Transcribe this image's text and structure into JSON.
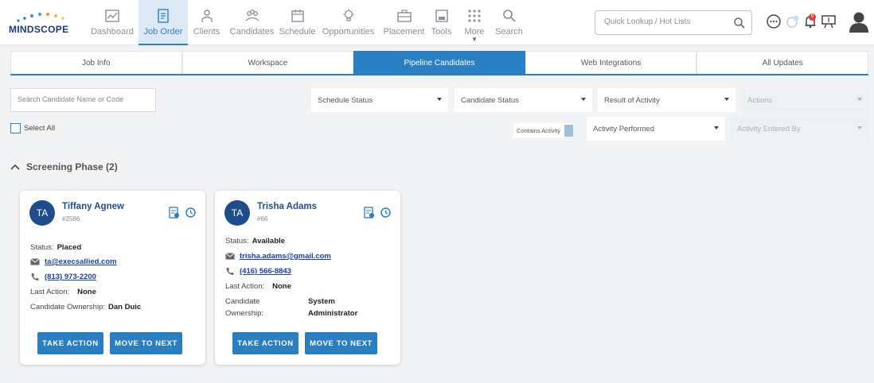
{
  "brand": {
    "logo_text": "MINDSCOPE",
    "accent": "#2a7ec2"
  },
  "nav": [
    {
      "label": "Dashboard",
      "icon": "dashboard-icon",
      "active": false
    },
    {
      "label": "Job Order",
      "icon": "job-order-icon",
      "active": true
    },
    {
      "label": "Clients",
      "icon": "clients-icon",
      "active": false
    },
    {
      "label": "Candidates",
      "icon": "candidates-icon",
      "active": false
    },
    {
      "label": "Schedule",
      "icon": "schedule-icon",
      "active": false
    },
    {
      "label": "Opportunities",
      "icon": "lightbulb-icon",
      "active": false
    },
    {
      "label": "Placement",
      "icon": "briefcase-icon",
      "active": false
    },
    {
      "label": "Tools",
      "icon": "tools-icon",
      "active": false
    },
    {
      "label": "More",
      "icon": "grid-icon",
      "active": false
    },
    {
      "label": "Search",
      "icon": "search-icon",
      "active": false
    }
  ],
  "header": {
    "lookup_placeholder": "Quick Lookup / Hot Lists",
    "notification_count": "0"
  },
  "tabs": [
    {
      "label": "Job Info",
      "active": false
    },
    {
      "label": "Workspace",
      "active": false
    },
    {
      "label": "Pipeline Candidates",
      "active": true
    },
    {
      "label": "Web Integrations",
      "active": false
    },
    {
      "label": "All Updates",
      "active": false
    }
  ],
  "filters": {
    "search_placeholder": "Search Candidate Name or Code",
    "schedule_status": "Schedule Status",
    "candidate_status": "Candidate Status",
    "result_of_activity": "Result of Activity",
    "actions": "Actions",
    "select_all": "Select All",
    "contains_activity": "Contains Activity",
    "activity_performed": "Activity Performed",
    "activity_entered_by": "Activity Entered By"
  },
  "phase": {
    "title": "Screening Phase (2)"
  },
  "labels": {
    "status": "Status:",
    "last_action": "Last Action:",
    "ownership": "Candidate Ownership:",
    "ownership_l1": "Candidate",
    "ownership_l2": "Ownership:",
    "take_action": "TAKE ACTION",
    "move_to_next": "MOVE TO NEXT"
  },
  "candidates": [
    {
      "initials": "TA",
      "name": "Tiffany Agnew",
      "code": "#2586",
      "status": "Placed",
      "email": "ta@execsallied.com",
      "phone": "(813) 973-2200",
      "last_action": "None",
      "owner": "Dan Duic"
    },
    {
      "initials": "TA",
      "name": "Trisha Adams",
      "code": "#66",
      "status": "Available",
      "email": "trisha.adams@gmail.com",
      "phone": "(416) 566-8843",
      "last_action": "None",
      "owner_l1": "System",
      "owner_l2": "Administrator"
    }
  ]
}
